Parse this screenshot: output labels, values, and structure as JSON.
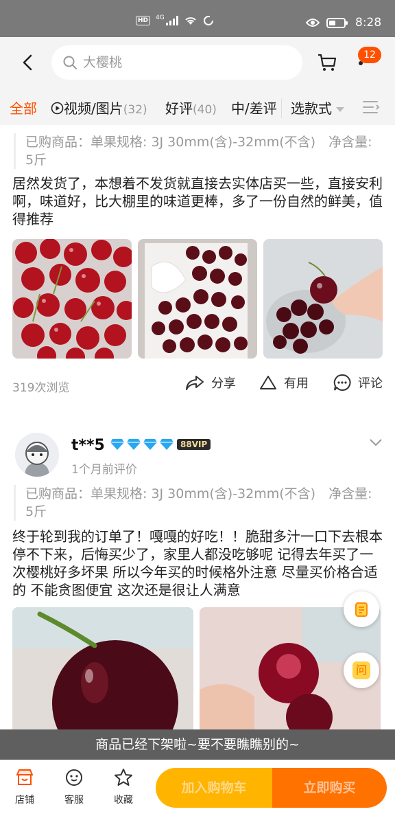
{
  "status_bar": {
    "hd": "HD",
    "network": "4G",
    "time": "8:28"
  },
  "header": {
    "search_placeholder": "大樱桃",
    "cart_badge": "12"
  },
  "tabs": [
    {
      "label": "全部",
      "count": "",
      "active": true
    },
    {
      "label": "视频/图片",
      "count": "(32)",
      "active": false
    },
    {
      "label": "好评",
      "count": "(40)",
      "active": false
    },
    {
      "label": "中/差评",
      "count": "",
      "active": false
    }
  ],
  "style_select": {
    "label": "选款式"
  },
  "review1": {
    "spec": "已购商品：单果规格: 3J 30mm(含)-32mm(不含)　净含量: 5斤",
    "text": "居然发货了，本想着不发货就直接去实体店买一些，直接安利啊，味道好，比大棚里的味道更棒，多了一份自然的鲜美，值得推荐",
    "views": "319次浏览",
    "share": "分享",
    "useful": "有用",
    "comment": "评论"
  },
  "review2": {
    "nickname": "t**5",
    "vip": "88VIP",
    "time": "1个月前评价",
    "spec": "已购商品：单果规格: 3J 30mm(含)-32mm(不含)　净含量: 5斤",
    "text": "终于轮到我的订单了！嘎嘎的好吃！！脆甜多汁一口下去根本停不下来，后悔买少了，家里人都没吃够呢  记得去年买了一次樱桃好多坏果  所以今年买的时候格外注意  尽量买价格合适的  不能贪图便宜  这次还是很让人满意"
  },
  "fab_ask": "问",
  "toast": "商品已经下架啦~要不要瞧瞧别的~",
  "bottom_bar": {
    "shop": "店铺",
    "service": "客服",
    "favorite": "收藏",
    "add_cart": "加入购物车",
    "buy_now": "立即购买"
  },
  "colors": {
    "accent": "#ff5000",
    "cart_button": "#ffb400",
    "buy_button": "#ff7200"
  }
}
